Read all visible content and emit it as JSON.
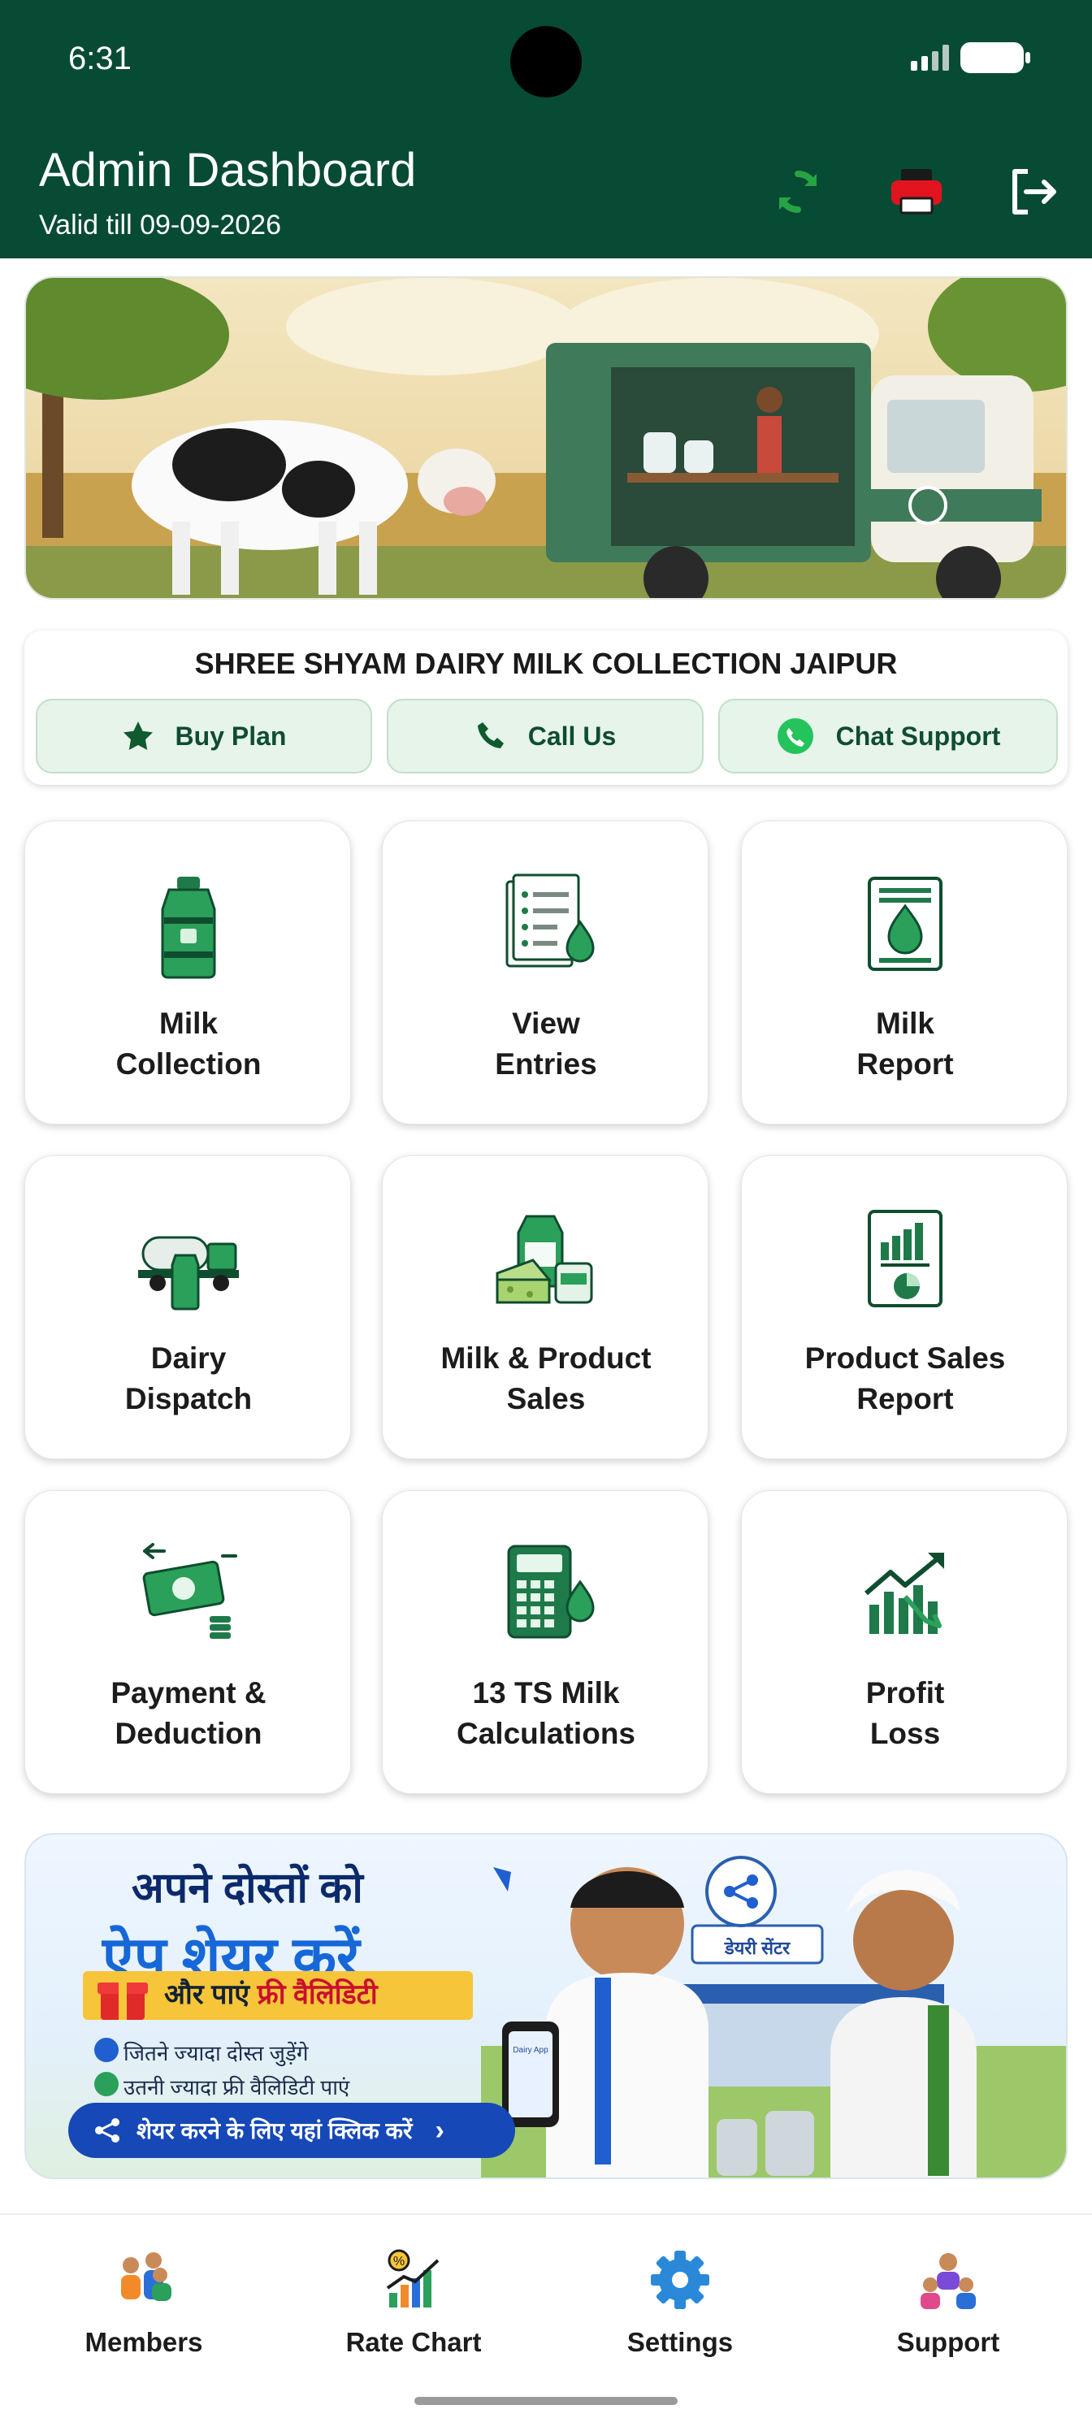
{
  "status_bar": {
    "time": "6:31"
  },
  "header": {
    "title": "Admin Dashboard",
    "subtitle": "Valid till 09-09-2026",
    "sync_icon": "sync-icon",
    "printer_icon": "printer-icon",
    "logout_icon": "logout-icon"
  },
  "info": {
    "dairy_name": "SHREE SHYAM DAIRY MILK COLLECTION JAIPUR",
    "buy_plan": "Buy Plan",
    "call_us": "Call Us",
    "chat_support": "Chat Support"
  },
  "tiles": [
    {
      "label": "Milk\nCollection",
      "icon": "milk-can-icon"
    },
    {
      "label": "View\nEntries",
      "icon": "entries-sheet-icon"
    },
    {
      "label": "Milk\nReport",
      "icon": "milk-report-icon"
    },
    {
      "label": "Dairy\nDispatch",
      "icon": "tanker-truck-icon"
    },
    {
      "label": "Milk & Product\nSales",
      "icon": "dairy-products-icon"
    },
    {
      "label": "Product Sales\nReport",
      "icon": "sales-report-icon"
    },
    {
      "label": "Payment &\nDeduction",
      "icon": "payment-icon"
    },
    {
      "label": "13 TS Milk\nCalculations",
      "icon": "calculator-icon"
    },
    {
      "label": "Profit\nLoss",
      "icon": "profit-chart-icon"
    }
  ],
  "share_banner": {
    "line1": "अपने दोस्तों को",
    "line2": "ऐप शेयर करें",
    "offer_prefix": "और पाएं",
    "offer_highlight": "फ्री वैलिडिटी",
    "point1": "जितने ज्यादा दोस्त जुड़ेंगे",
    "point2": "उतनी ज्यादा फ्री वैलिडिटी पाएं",
    "cta": "शेयर करने के लिए यहां क्लिक करें",
    "shop_sign": "डेयरी सेंटर",
    "phone_text": "Dairy App"
  },
  "bottom_nav": [
    {
      "label": "Members",
      "icon": "members-icon"
    },
    {
      "label": "Rate Chart",
      "icon": "rate-chart-icon"
    },
    {
      "label": "Settings",
      "icon": "settings-gear-icon"
    },
    {
      "label": "Support",
      "icon": "support-icon"
    }
  ],
  "colors": {
    "header_bg": "#074b34",
    "accent_green": "#1a8a4a",
    "pill_bg": "#e7f4ea",
    "cta_blue": "#1648b8",
    "settings_blue": "#2a88d8"
  }
}
